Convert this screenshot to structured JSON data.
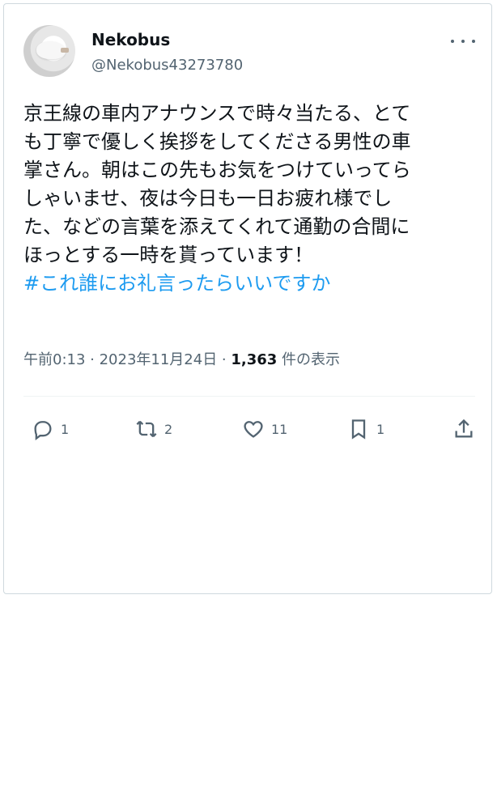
{
  "user": {
    "name": "Nekobus",
    "handle": "@Nekobus43273780"
  },
  "tweet": {
    "text_lines": [
      "京王線の車内アナウンスで時々当たる、とて",
      "も丁寧で優しく挨拶をしてくださる男性の車",
      "掌さん。朝はこの先もお気をつけていってら",
      "しゃいませ、夜は今日も一日お疲れ様でし",
      "た、などの言葉を添えてくれて通勤の合間に",
      "ほっとする一時を貰っています！"
    ],
    "hashtag": "#これ誰にお礼言ったらいいですか"
  },
  "meta": {
    "time_date": "午前0:13 · 2023年11月24日 · ",
    "views_count": "1,363",
    "views_label": " 件の表示"
  },
  "actions": {
    "reply_count": "1",
    "retweet_count": "2",
    "like_count": "11",
    "bookmark_count": "1"
  },
  "colors": {
    "link": "#1d9bf0",
    "secondary_text": "#536471",
    "primary_text": "#0f1419"
  }
}
